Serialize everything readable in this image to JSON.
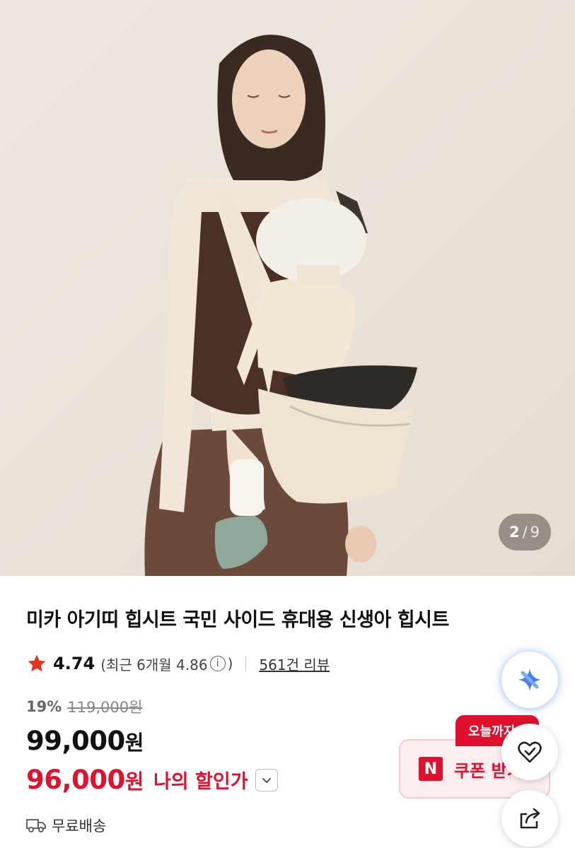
{
  "gallery": {
    "current": "2",
    "separator": "/",
    "total": "9"
  },
  "product": {
    "title": "미카 아기띠 힙시트 국민 사이드 휴대용 신생아 힙시트",
    "rating": "4.74",
    "recent_rating_prefix": "(최근 6개월 4.86",
    "recent_rating_suffix": ")",
    "info_glyph": "i",
    "review_count": "561건 리뷰",
    "discount_rate": "19%",
    "original_price": "119,000원",
    "price_number": "99,000",
    "price_unit": "원",
    "my_price_number": "96,000",
    "my_price_unit": "원",
    "my_price_label": "나의 할인가",
    "shipping": "무료배송"
  },
  "coupon": {
    "tag": "오늘까지",
    "badge": "N",
    "label": "쿠폰 받기"
  },
  "icons": {
    "star": "star-icon",
    "info": "info-icon",
    "dropdown": "chevron-down-icon",
    "truck": "truck-icon",
    "ai": "ai-sparkle-icon",
    "like": "heart-check-icon",
    "share": "share-icon"
  },
  "colors": {
    "accent": "#e0102f",
    "coupon_bg": "#fdeef0",
    "star": "#e8321e",
    "hero_bg": "#ece6de"
  }
}
